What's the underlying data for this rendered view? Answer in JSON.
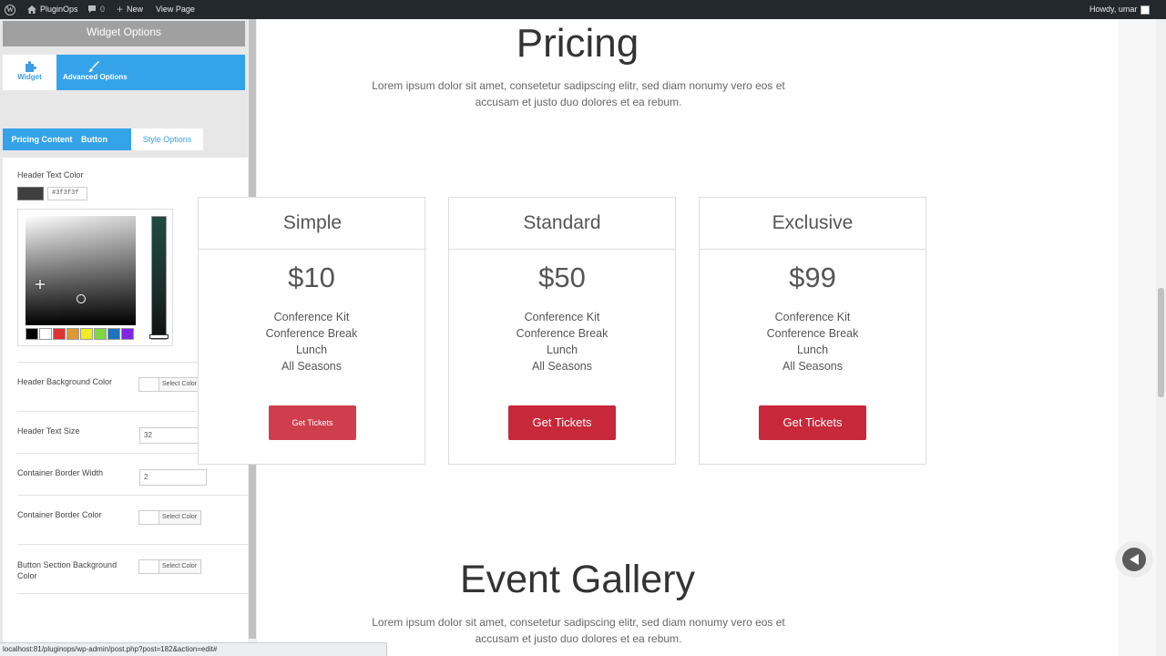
{
  "admin_bar": {
    "site_name": "PluginOps",
    "comments_count": "0",
    "new_label": "New",
    "view_page_label": "View Page",
    "greeting": "Howdy, umar"
  },
  "sidebar": {
    "title": "Widget Options",
    "top_tabs": {
      "widget": "Widget",
      "advanced": "Advanced Options"
    },
    "sub_tabs": {
      "pricing_content": "Pricing Content",
      "button": "Button",
      "style_options": "Style Options"
    },
    "header_text_color": {
      "label": "Header Text Color",
      "value": "#3f3f3f"
    },
    "palette": [
      "#000000",
      "#ffffff",
      "#dd3333",
      "#dd9933",
      "#eeee22",
      "#81d742",
      "#1e73be",
      "#8224e3"
    ],
    "header_bg_color": {
      "label": "Header Background Color",
      "button": "Select Color"
    },
    "header_text_size": {
      "label": "Header Text Size",
      "value": "32"
    },
    "container_border_width": {
      "label": "Container Border Width",
      "value": "2"
    },
    "container_border_color": {
      "label": "Container Border Color",
      "button": "Select Color"
    },
    "button_section_bg_color": {
      "label": "Button Section Background Color",
      "button": "Select Color"
    }
  },
  "page": {
    "pricing_title": "Pricing",
    "pricing_text_line1": "Lorem ipsum dolor sit amet, consetetur sadipscing elitr, sed diam nonumy vero eos et",
    "pricing_text_line2": "accusam et justo duo dolores et ea rebum.",
    "cards": [
      {
        "name": "Simple",
        "price": "$10",
        "features": [
          "Conference Kit",
          "Conference Break",
          "Lunch",
          "All Seasons"
        ],
        "button": "Get Tickets"
      },
      {
        "name": "Standard",
        "price": "$50",
        "features": [
          "Conference Kit",
          "Conference Break",
          "Lunch",
          "All Seasons"
        ],
        "button": "Get Tickets"
      },
      {
        "name": "Exclusive",
        "price": "$99",
        "features": [
          "Conference Kit",
          "Conference Break",
          "Lunch",
          "All Seasons"
        ],
        "button": "Get Tickets"
      }
    ],
    "gallery_title": "Event Gallery",
    "gallery_text_line1": "Lorem ipsum dolor sit amet, consetetur sadipscing elitr, sed diam nonumy vero eos et",
    "gallery_text_line2": "accusam et justo duo dolores et ea rebum."
  },
  "status_url": "localhost:81/pluginops/wp-admin/post.php?post=182&action=edit#",
  "colors": {
    "accent": "#34a3ea",
    "button_red": "#c7283a",
    "admin_bar": "#23282d"
  }
}
